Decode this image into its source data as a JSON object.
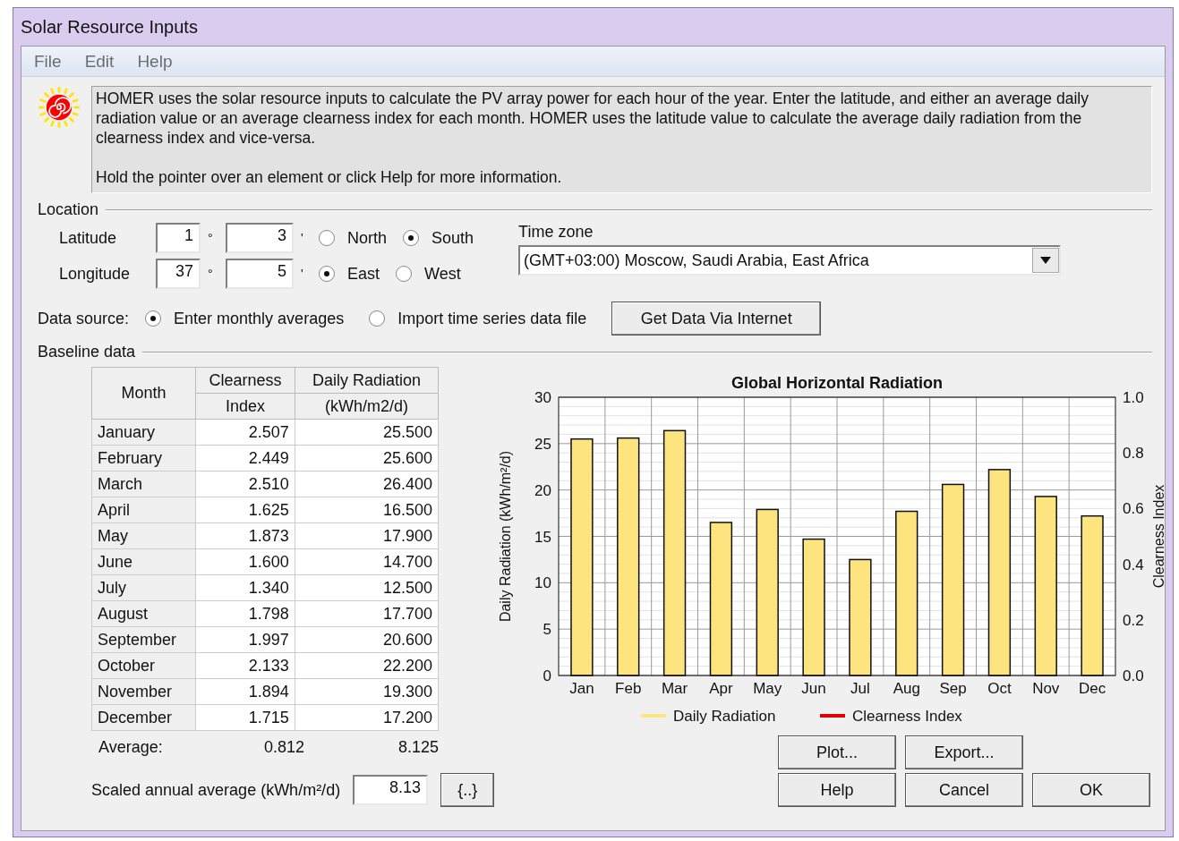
{
  "window": {
    "title": "Solar Resource Inputs"
  },
  "menu": [
    "File",
    "Edit",
    "Help"
  ],
  "info": {
    "lines": [
      "HOMER uses the solar resource inputs to calculate the PV array power for each hour of the year. Enter the latitude, and either an average daily radiation value or an average clearness index for each month. HOMER uses the latitude value to calculate the average daily radiation from the clearness index and vice-versa.",
      "Hold the pointer over an element or click Help for more information."
    ]
  },
  "location": {
    "title": "Location",
    "latitude": {
      "label": "Latitude",
      "degrees": "1",
      "deg_mark": "°",
      "minutes": "3",
      "min_mark": "'",
      "options": [
        {
          "label": "North",
          "selected": false
        },
        {
          "label": "South",
          "selected": true
        }
      ]
    },
    "longitude": {
      "label": "Longitude",
      "degrees": "37",
      "deg_mark": "°",
      "minutes": "5",
      "min_mark": "'",
      "options": [
        {
          "label": "East",
          "selected": true
        },
        {
          "label": "West",
          "selected": false
        }
      ]
    },
    "time_zone": {
      "label": "Time zone",
      "value": "(GMT+03:00) Moscow, Saudi Arabia, East Africa"
    }
  },
  "data_source": {
    "label": "Data source:",
    "options": [
      {
        "label": "Enter monthly averages",
        "selected": true
      },
      {
        "label": "Import time series data file",
        "selected": false
      }
    ],
    "button": "Get Data Via Internet"
  },
  "baseline": {
    "title": "Baseline data",
    "table": {
      "columns": [
        "Month",
        [
          "Clearness",
          "Index"
        ],
        [
          "Daily Radiation",
          "(kWh/m2/d)"
        ]
      ],
      "rows": [
        [
          "January",
          "2.507",
          "25.500"
        ],
        [
          "February",
          "2.449",
          "25.600"
        ],
        [
          "March",
          "2.510",
          "26.400"
        ],
        [
          "April",
          "1.625",
          "16.500"
        ],
        [
          "May",
          "1.873",
          "17.900"
        ],
        [
          "June",
          "1.600",
          "14.700"
        ],
        [
          "July",
          "1.340",
          "12.500"
        ],
        [
          "August",
          "1.798",
          "17.700"
        ],
        [
          "September",
          "1.997",
          "20.600"
        ],
        [
          "October",
          "2.133",
          "22.200"
        ],
        [
          "November",
          "1.894",
          "19.300"
        ],
        [
          "December",
          "1.715",
          "17.200"
        ]
      ],
      "average": {
        "label": "Average:",
        "clearness": "0.812",
        "radiation": "8.125"
      }
    },
    "chart": {
      "chart_data": {
        "type": "bar",
        "title": "Global Horizontal Radiation",
        "ylabel": "Daily Radiation (kWh/m²/d)",
        "y2label": "Clearness Index",
        "categories": [
          "Jan",
          "Feb",
          "Mar",
          "Apr",
          "May",
          "Jun",
          "Jul",
          "Aug",
          "Sep",
          "Oct",
          "Nov",
          "Dec"
        ],
        "series": [
          {
            "name": "Daily Radiation",
            "color": "#fde47f",
            "values": [
              25.5,
              25.6,
              26.4,
              16.5,
              17.9,
              14.7,
              12.5,
              17.7,
              20.6,
              22.2,
              19.3,
              17.2
            ]
          }
        ],
        "ylim": [
          0,
          30
        ],
        "yticks": [
          0,
          5,
          10,
          15,
          20,
          25,
          30
        ],
        "y2ticks": [
          "0.0",
          "0.2",
          "0.4",
          "0.6",
          "0.8",
          "1.0"
        ],
        "grid": true
      },
      "legend_extra": {
        "name": "Clearness Index",
        "color": "#e00000"
      }
    }
  },
  "scaled": {
    "label": "Scaled annual average (kWh/m²/d)",
    "value": "8.13",
    "button": "{..}"
  },
  "buttons": [
    [
      "Plot...",
      "Export..."
    ],
    [
      "Help",
      "Cancel",
      "OK"
    ]
  ]
}
